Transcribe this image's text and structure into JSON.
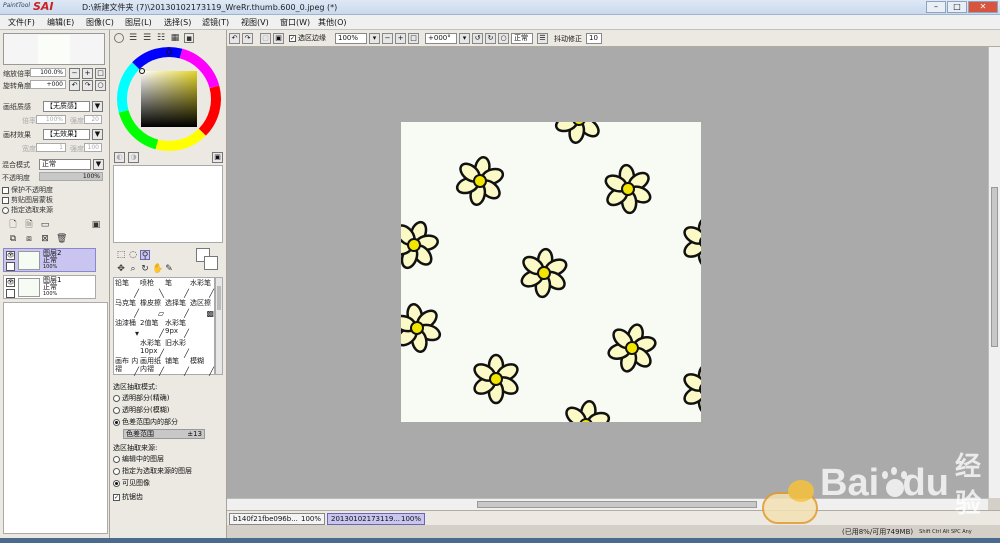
{
  "app": {
    "logo_small": "PaintTool",
    "logo_big": "SAI",
    "window_title": "D:\\新建文件夹 (7)\\20130102173119_WreRr.thumb.600_0.jpeg (*)"
  },
  "menu": [
    "文件(F)",
    "编辑(E)",
    "图像(C)",
    "图层(L)",
    "选择(S)",
    "滤镜(T)",
    "视图(V)",
    "窗口(W)",
    "其他(O)"
  ],
  "navigator": {
    "zoom_label": "缩放倍率",
    "zoom_value": "100.0%",
    "rotate_label": "旋转角度",
    "rotate_value": "+000"
  },
  "layer_props": {
    "paper_texture_label": "画纸质感",
    "paper_texture_value": "【无质感】",
    "scale_label": "倍率",
    "scale_value": "100%",
    "strength_label": "强度",
    "strength_value": "20",
    "material_effect_label": "画材效果",
    "material_effect_value": "【无效果】",
    "width_label": "宽度",
    "width_value": "1",
    "strength2_label": "强度",
    "strength2_value": "100",
    "blend_mode_label": "混合模式",
    "blend_mode_value": "正常",
    "opacity_label": "不透明度",
    "opacity_value": "100%",
    "protect_opacity": "保护不透明度",
    "clipping_group": "剪贴图层蒙板",
    "selection_source": "指定选取来源"
  },
  "layers": [
    {
      "name": "图层2",
      "mode": "正常",
      "opacity": "100%",
      "selected": true
    },
    {
      "name": "图层1",
      "mode": "正常",
      "opacity": "100%",
      "selected": false
    }
  ],
  "brushes": [
    {
      "label": "铅笔",
      "icon": "pencil-icon"
    },
    {
      "label": "喷枪",
      "icon": "airbrush-icon"
    },
    {
      "label": "笔",
      "icon": "pen-icon"
    },
    {
      "label": "水彩笔",
      "icon": "watercolor-icon"
    },
    {
      "label": "马克笔",
      "icon": "marker-icon"
    },
    {
      "label": "橡皮擦",
      "icon": "eraser-icon"
    },
    {
      "label": "选择笔",
      "icon": "select-pen-icon"
    },
    {
      "label": "选区擦",
      "icon": "select-eraser-icon"
    },
    {
      "label": "油漆桶",
      "icon": "bucket-icon"
    },
    {
      "label": "2值笔",
      "icon": "binary-pen-icon"
    },
    {
      "label": "水彩笔 9px",
      "icon": "watercolor-icon"
    },
    {
      "label": "",
      "icon": ""
    },
    {
      "label": "",
      "icon": ""
    },
    {
      "label": "水彩笔 10px",
      "icon": "watercolor-icon"
    },
    {
      "label": "旧水彩",
      "icon": "old-watercolor-icon"
    },
    {
      "label": "",
      "icon": ""
    },
    {
      "label": "画布 内褶",
      "icon": "canvas-icon"
    },
    {
      "label": "画用纸 内褶",
      "icon": "paper-icon"
    },
    {
      "label": "铺笔",
      "icon": "brush-icon"
    },
    {
      "label": "模糊",
      "icon": "blur-icon"
    }
  ],
  "magic_wand": {
    "mode_title": "选区抽取模式:",
    "mode_options": [
      "透明部分(精确)",
      "透明部分(模糊)",
      "色差范围内的部分"
    ],
    "mode_selected": 2,
    "tolerance_label": "色差范围",
    "tolerance_value": "±13",
    "source_title": "选区抽取来源:",
    "source_options": [
      "编辑中的图层",
      "指定为选取来源的图层",
      "可见图像"
    ],
    "source_selected": 2,
    "antialias_label": "抗锯齿",
    "antialias_checked": true
  },
  "toolbar": {
    "selection_edge_label": "选区边缘",
    "zoom_value": "100%",
    "rotate_value": "+000°",
    "blend_value": "正常",
    "stabilizer_label": "抖动修正",
    "stabilizer_value": "10"
  },
  "doc_tabs": [
    {
      "label": "b140f21fbe096b...",
      "zoom": "100%",
      "active": false
    },
    {
      "label": "20130102173119...",
      "zoom": "100%",
      "active": true
    }
  ],
  "status": {
    "memory": "(已用8%/可用749MB)",
    "keys": "Shift Ctrl Alt SPC Any"
  },
  "colors": {
    "layer_selected": "#c9c5f0",
    "canvas_bg": "#aaaaaa",
    "paper": "#f7fbf4",
    "petal": "#fbf9c6",
    "center": "#f2e600"
  },
  "watermark": {
    "brand": "Bai",
    "brand2": "du",
    "suffix": "经验"
  }
}
